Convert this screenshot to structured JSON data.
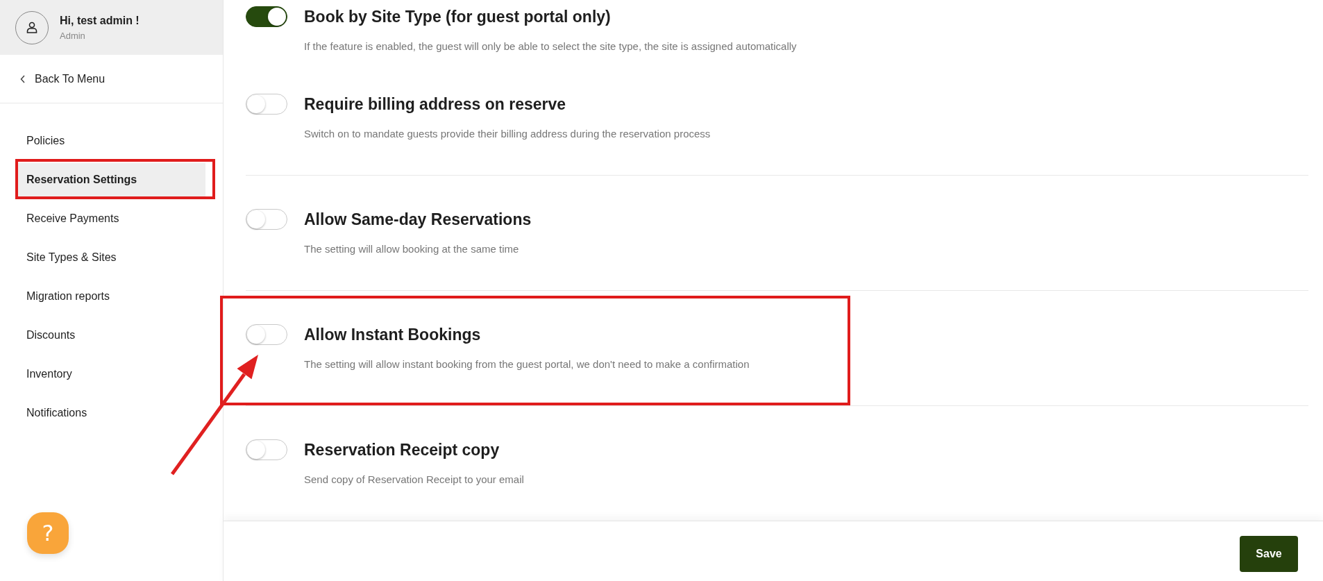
{
  "user": {
    "greeting": "Hi, test admin !",
    "role": "Admin"
  },
  "back_link": {
    "label": "Back To Menu"
  },
  "sidebar": {
    "items": [
      {
        "label": "Policies",
        "selected": false,
        "annotated": false
      },
      {
        "label": "Reservation Settings",
        "selected": true,
        "annotated": true
      },
      {
        "label": "Receive Payments",
        "selected": false,
        "annotated": false
      },
      {
        "label": "Site Types & Sites",
        "selected": false,
        "annotated": false
      },
      {
        "label": "Migration reports",
        "selected": false,
        "annotated": false
      },
      {
        "label": "Discounts",
        "selected": false,
        "annotated": false
      },
      {
        "label": "Inventory",
        "selected": false,
        "annotated": false
      },
      {
        "label": "Notifications",
        "selected": false,
        "annotated": false
      }
    ]
  },
  "help_button": {
    "label": "?"
  },
  "sections": [
    {
      "settings": [
        {
          "title": "Book by Site Type (for guest portal only)",
          "description": "If the feature is enabled, the guest will only be able to select the site type, the site is assigned automatically",
          "on": true,
          "annotated": false
        },
        {
          "title": "Require billing address on reserve",
          "description": "Switch on to mandate guests provide their billing address during the reservation process",
          "on": false,
          "annotated": false
        }
      ]
    },
    {
      "settings": [
        {
          "title": "Allow Same-day Reservations",
          "description": "The setting will allow booking at the same time",
          "on": false,
          "annotated": false
        }
      ]
    },
    {
      "settings": [
        {
          "title": "Allow Instant Bookings",
          "description": "The setting will allow instant booking from the guest portal, we don't need to make a confirmation",
          "on": false,
          "annotated": true
        }
      ]
    },
    {
      "settings": [
        {
          "title": "Reservation Receipt copy",
          "description": "Send copy of Reservation Receipt to your email",
          "on": false,
          "annotated": false
        }
      ]
    }
  ],
  "footer": {
    "save_label": "Save"
  }
}
